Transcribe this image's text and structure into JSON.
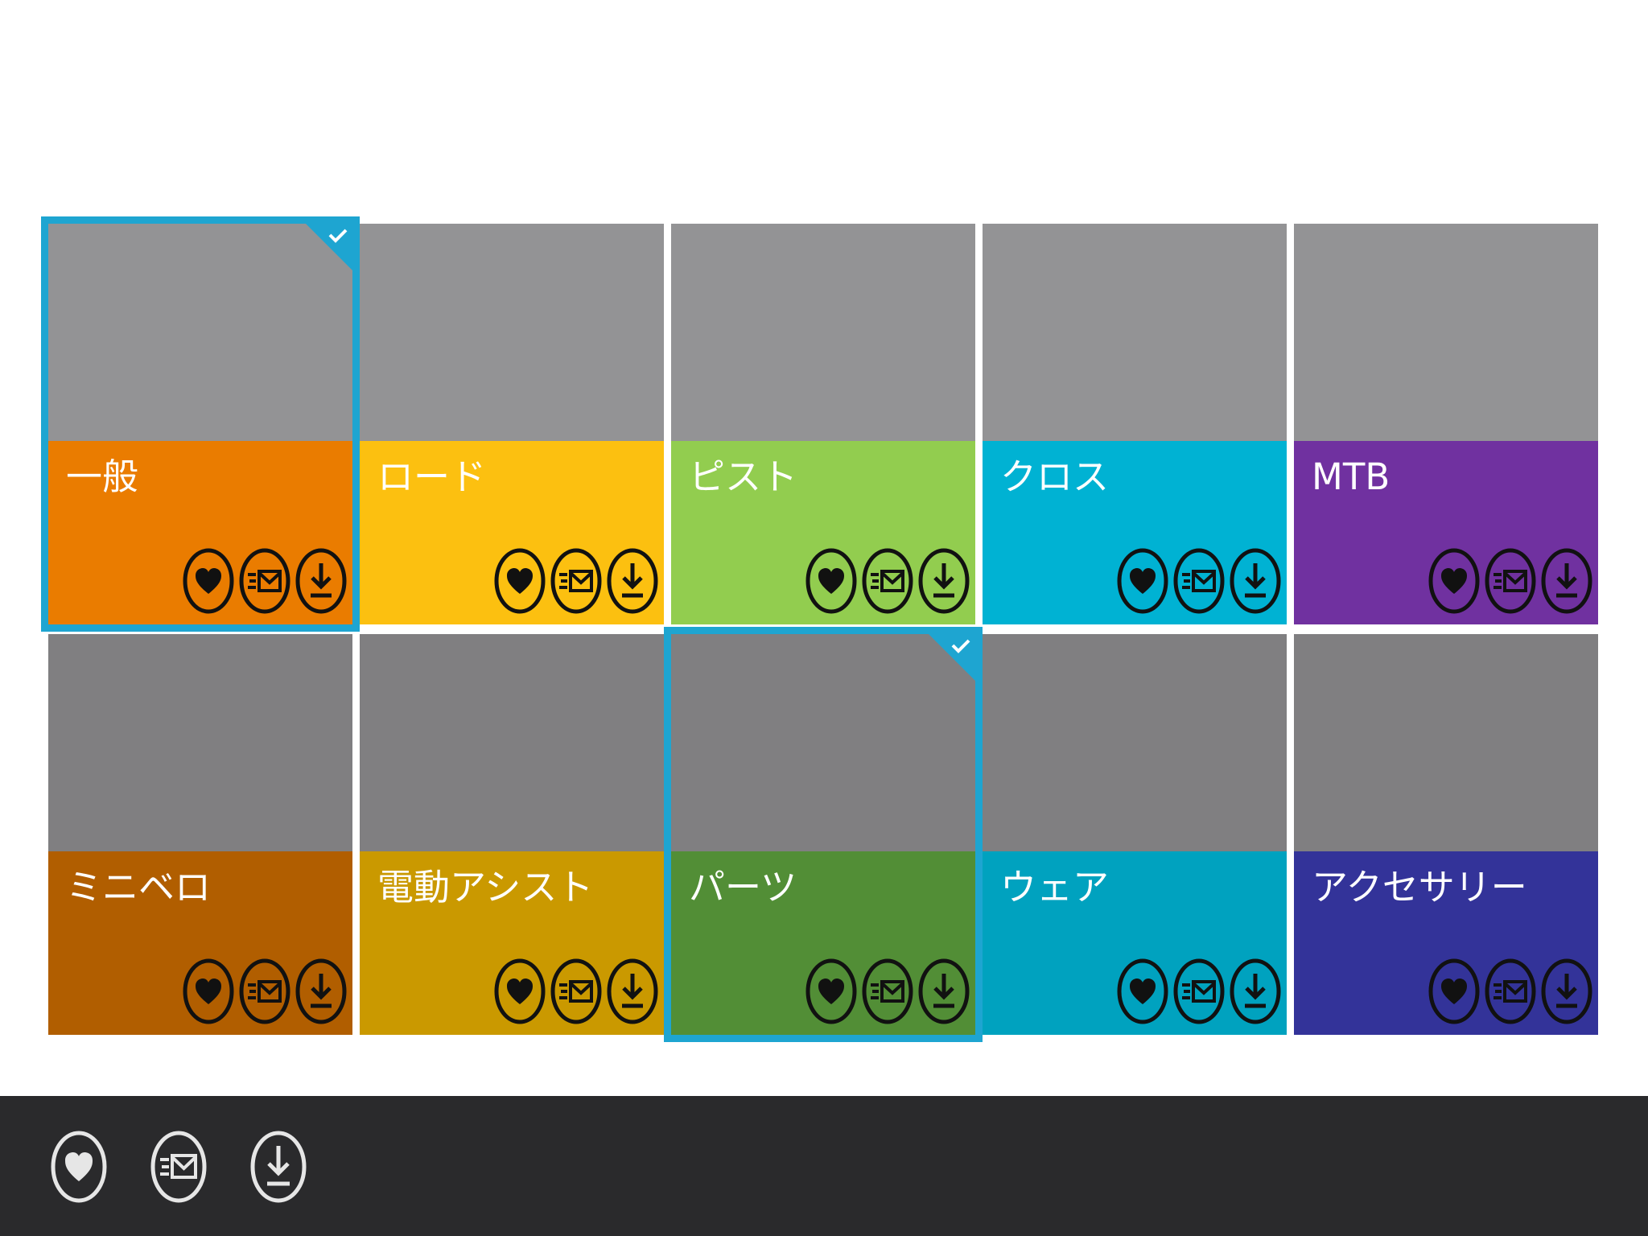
{
  "tiles": [
    {
      "label": "一般",
      "color": "#ea7c00",
      "selected": true
    },
    {
      "label": "ロード",
      "color": "#fcc010",
      "selected": false
    },
    {
      "label": "ピスト",
      "color": "#92cd4f",
      "selected": false
    },
    {
      "label": "クロス",
      "color": "#00b2d3",
      "selected": false
    },
    {
      "label": "MTB",
      "color": "#7031a0",
      "selected": false
    },
    {
      "label": "ミニベロ",
      "color": "#b15e00",
      "selected": false
    },
    {
      "label": "電動アシスト",
      "color": "#ca9900",
      "selected": false
    },
    {
      "label": "パーツ",
      "color": "#528e36",
      "selected": true
    },
    {
      "label": "ウェア",
      "color": "#00a2bf",
      "selected": false
    },
    {
      "label": "アクセサリー",
      "color": "#333399",
      "selected": false
    }
  ],
  "tile_icons": [
    "heart-icon",
    "mail-list-icon",
    "download-icon"
  ],
  "app_bar": {
    "buttons": [
      "heart-icon",
      "mail-list-icon",
      "download-icon"
    ],
    "background": "#2a2a2c",
    "icon_color": "#e6e6e6"
  },
  "selection_color": "#1ea5d1"
}
